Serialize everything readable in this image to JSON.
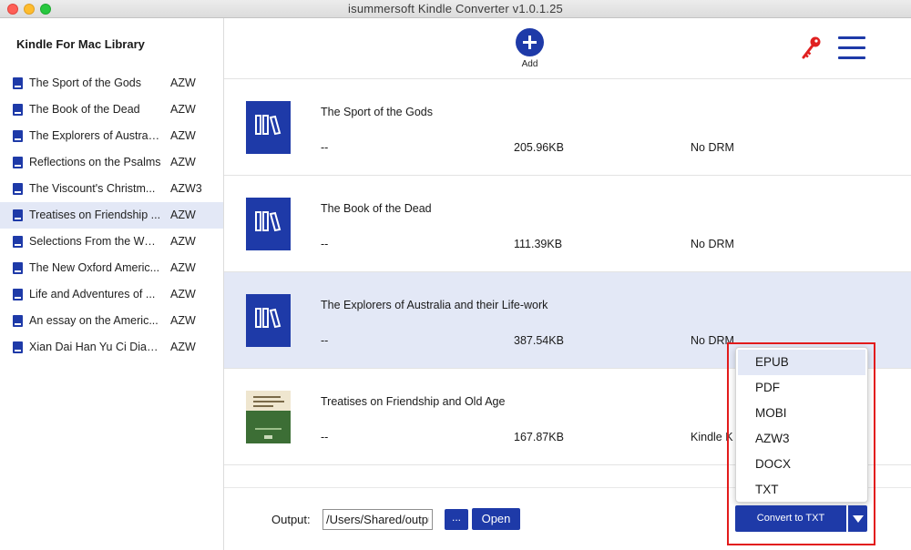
{
  "window": {
    "title": "isummersoft Kindle Converter v1.0.1.25"
  },
  "sidebar": {
    "title": "Kindle For Mac Library",
    "items": [
      {
        "label": "The Sport of the Gods",
        "format": "AZW"
      },
      {
        "label": "The Book of the Dead",
        "format": "AZW"
      },
      {
        "label": "The Explorers of Australi...",
        "format": "AZW"
      },
      {
        "label": "Reflections on the Psalms",
        "format": "AZW"
      },
      {
        "label": "The Viscount's Christm...",
        "format": "AZW3"
      },
      {
        "label": "Treatises on Friendship ...",
        "format": "AZW"
      },
      {
        "label": "Selections From the Wor...",
        "format": "AZW"
      },
      {
        "label": "The New Oxford Americ...",
        "format": "AZW"
      },
      {
        "label": "Life and Adventures of ...",
        "format": "AZW"
      },
      {
        "label": "An essay on the Americ...",
        "format": "AZW"
      },
      {
        "label": "Xian Dai Han Yu Ci Dian ...",
        "format": "AZW"
      }
    ],
    "selected_index": 5
  },
  "toolbar": {
    "add_label": "Add"
  },
  "books": [
    {
      "title": "The Sport of the Gods",
      "author": "--",
      "size": "205.96KB",
      "drm": "No DRM",
      "cover": "default"
    },
    {
      "title": "The Book of the Dead",
      "author": "--",
      "size": "111.39KB",
      "drm": "No DRM",
      "cover": "default"
    },
    {
      "title": "The Explorers of Australia and their Life-work",
      "author": "--",
      "size": "387.54KB",
      "drm": "No DRM",
      "cover": "default"
    },
    {
      "title": "Treatises on Friendship and Old Age",
      "author": "--",
      "size": "167.87KB",
      "drm": "Kindle K",
      "cover": "image"
    }
  ],
  "footer": {
    "output_label": "Output:",
    "output_value": "/Users/Shared/outpu",
    "browse_label": "...",
    "open_label": "Open"
  },
  "format_menu": {
    "options": [
      "EPUB",
      "PDF",
      "MOBI",
      "AZW3",
      "DOCX",
      "TXT"
    ],
    "highlighted": "EPUB"
  },
  "convert": {
    "label": "Convert to TXT"
  },
  "colors": {
    "accent": "#1e3aa8",
    "selection": "#e3e8f6",
    "highlight_border": "#e21b1b",
    "key": "#e02020"
  }
}
